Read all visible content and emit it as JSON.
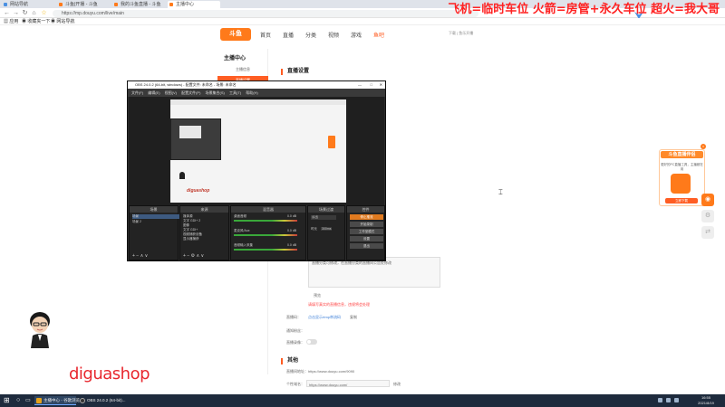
{
  "browser": {
    "tabs": [
      {
        "label": "网站导航"
      },
      {
        "label": "斗鱼|开播 - 斗鱼"
      },
      {
        "label": "我的斗鱼直播 - 斗鱼"
      },
      {
        "label": "主播中心"
      }
    ],
    "url": "https://mp.douyu.com/live/main",
    "bookmarks": [
      "应用",
      "收藏夹一下",
      "网站导航"
    ]
  },
  "overlay_text": "飞机=临时车位  火箭=房管+永久车位  超火=我大哥",
  "site": {
    "logo": "斗鱼",
    "nav": [
      {
        "label": "首页"
      },
      {
        "label": "直播"
      },
      {
        "label": "分类"
      },
      {
        "label": "视频"
      },
      {
        "label": "游戏"
      },
      {
        "label": "鱼吧"
      }
    ],
    "user": "下载  |  鱼乐开播"
  },
  "sidebar": {
    "title": "主播中心",
    "items": [
      {
        "label": "主播信息"
      },
      {
        "label": "直播设置"
      }
    ]
  },
  "main": {
    "section_title": "直播设置",
    "info_note": "直播分类可修改，在直播分类的直播间公告处修改",
    "warn_note": "请填写真实的直播信息，违规将会处理",
    "preview_label": "预览",
    "stream_key_label": "直播码：",
    "stream_key_link": "点击显示rtmp串流码",
    "stream_key_action": "复制",
    "notify_label": "通知粉丝：",
    "record_label": "直播录像：",
    "other_title": "其他",
    "room_link_label": "直播间地址：",
    "room_link_value": "https://www.douyu.com/9090",
    "custom_label": "个性域名：",
    "custom_value": "https://www.douyu.com/",
    "custom_action": "修改"
  },
  "promo": {
    "title": "斗鱼直播伴侣",
    "subtitle": "更好的PC直播工具，主播都在用",
    "button": "立即下载"
  },
  "obs": {
    "title": "OBS 24.0.2 (64-bit, windows) - 配置文件: 未命名 - 场景: 未命名",
    "menu": "文件(F) 编辑(E) 视图(V) 配置文件(P) 场景集合(S) 工具(T) 帮助(H)",
    "preview_watermark": "diguashop",
    "docks": {
      "scenes": {
        "title": "场景",
        "items": [
          "场景",
          "场景 2"
        ]
      },
      "sources": {
        "title": "来源",
        "items": [
          "媒体源",
          "文字 GDI+ 2",
          "图像",
          "文字 GDI+",
          "视频捕获设备",
          "显示器捕获"
        ]
      },
      "mixer": {
        "title": "混音器",
        "tracks": [
          "桌面音频",
          "麦克风/Aux",
          "音频输入采集"
        ],
        "levels": [
          "0.0 dB",
          "0.0 dB",
          "0.0 dB"
        ]
      },
      "transitions": {
        "title": "场景过渡",
        "type": "淡出",
        "duration_label": "时长",
        "duration": "300ms"
      },
      "controls": {
        "title": "控件",
        "buttons": [
          "停止推流",
          "开始录制",
          "工作室模式",
          "设置",
          "退出"
        ]
      }
    }
  },
  "streamer_watermark": "diguashop",
  "taskbar": {
    "items": [
      {
        "label": "主播中心 - 谷歌浏览..."
      },
      {
        "label": "OBS 24.0.2 (64-bit)..."
      }
    ],
    "time": "16:55",
    "date": "2021/8/19"
  }
}
